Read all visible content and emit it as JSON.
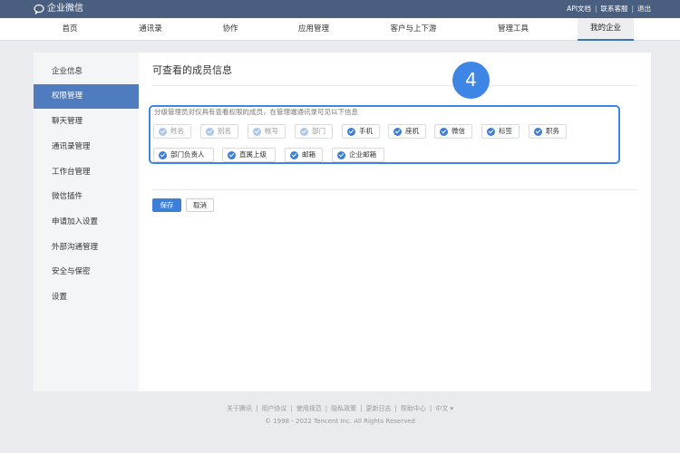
{
  "topbar": {
    "app_name": "企业微信",
    "links": [
      "API文档",
      "联系客服",
      "退出"
    ]
  },
  "nav": {
    "items": [
      "首页",
      "通讯录",
      "协作",
      "应用管理",
      "客户与上下游",
      "管理工具",
      "我的企业"
    ],
    "active": "我的企业"
  },
  "sidebar": {
    "items": [
      "企业信息",
      "权限管理",
      "聊天管理",
      "通讯录管理",
      "工作台管理",
      "微信插件",
      "申请加入设置",
      "外部沟通管理",
      "安全与保密",
      "设置"
    ],
    "active": "权限管理"
  },
  "content": {
    "title": "可查看的成员信息",
    "step_number": "4",
    "description": "分级管理员对仅具有查看权限的成员，在管理端通讯录可见以下信息",
    "fields": [
      {
        "label": "姓名",
        "checked": true,
        "disabled": true
      },
      {
        "label": "别名",
        "checked": true,
        "disabled": true
      },
      {
        "label": "帐号",
        "checked": true,
        "disabled": true
      },
      {
        "label": "部门",
        "checked": true,
        "disabled": true
      },
      {
        "label": "手机",
        "checked": true,
        "disabled": false
      },
      {
        "label": "座机",
        "checked": true,
        "disabled": false
      },
      {
        "label": "微信",
        "checked": true,
        "disabled": false
      },
      {
        "label": "标签",
        "checked": true,
        "disabled": false
      },
      {
        "label": "职务",
        "checked": true,
        "disabled": false
      },
      {
        "label": "部门负责人",
        "checked": true,
        "disabled": false
      },
      {
        "label": "直属上级",
        "checked": true,
        "disabled": false
      },
      {
        "label": "邮箱",
        "checked": true,
        "disabled": false
      },
      {
        "label": "企业邮箱",
        "checked": true,
        "disabled": false
      }
    ],
    "save_label": "保存",
    "cancel_label": "取消"
  },
  "footer": {
    "links": [
      "关于腾讯",
      "用户协议",
      "使用规范",
      "隐私政策",
      "更新日志",
      "帮助中心",
      "中文 ▾"
    ],
    "copyright": "© 1998 - 2022 Tencent Inc. All Rights Reserved"
  },
  "colors": {
    "topbar": "#4a5f80",
    "accent": "#3d7fd8",
    "sidebar_active": "#4f7cbf",
    "highlight": "#3d86e6"
  }
}
